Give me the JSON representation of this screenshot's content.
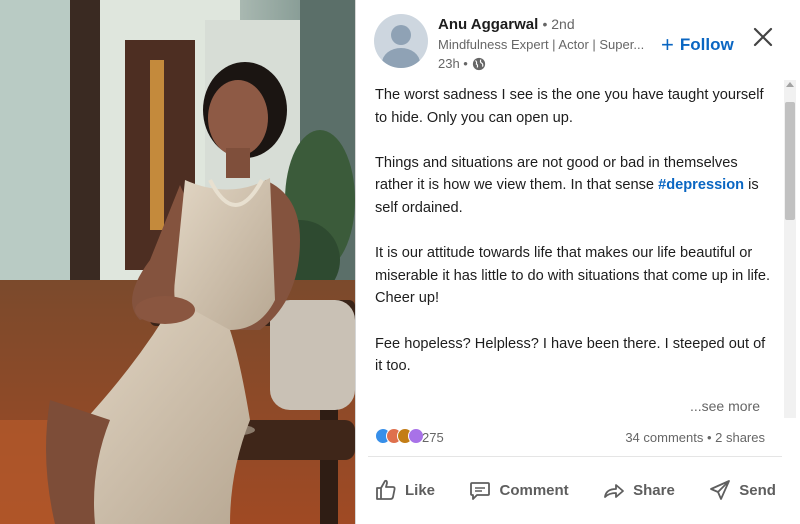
{
  "post": {
    "author": {
      "name": "Anu Aggarwal",
      "degree": "• 2nd",
      "headline": "Mindfulness Expert | Actor | Super...",
      "time": "23h •"
    },
    "follow_label": "Follow",
    "paragraphs": {
      "p1": "The worst sadness I see is the one you have taught yourself to hide. Only you can open up.",
      "p2_before": "Things and situations are not good or bad in themselves rather it is how we view them. In that sense ",
      "p2_hashtag": "#depression",
      "p2_after": " is self ordained.",
      "p3": "It is our attitude towards life that makes our life beautiful or miserable it has little to do with situations that come up in life.",
      "p4": "Cheer up!",
      "p5": "Fee hopeless? Helpless? I have been there. I steeped out of it too."
    },
    "see_more": "...see more",
    "reaction_count": "275",
    "comments_shares": "34 comments • 2 shares"
  },
  "actions": {
    "like": "Like",
    "comment": "Comment",
    "repost": "Share",
    "send": "Send"
  },
  "icons": {
    "close": "close-icon",
    "globe": "globe-icon",
    "like": "thumbs-up-icon",
    "comment": "comment-icon",
    "share": "share-arrow-icon",
    "send": "send-icon"
  },
  "colors": {
    "accent": "#0a66c2",
    "muted": "#666666"
  }
}
